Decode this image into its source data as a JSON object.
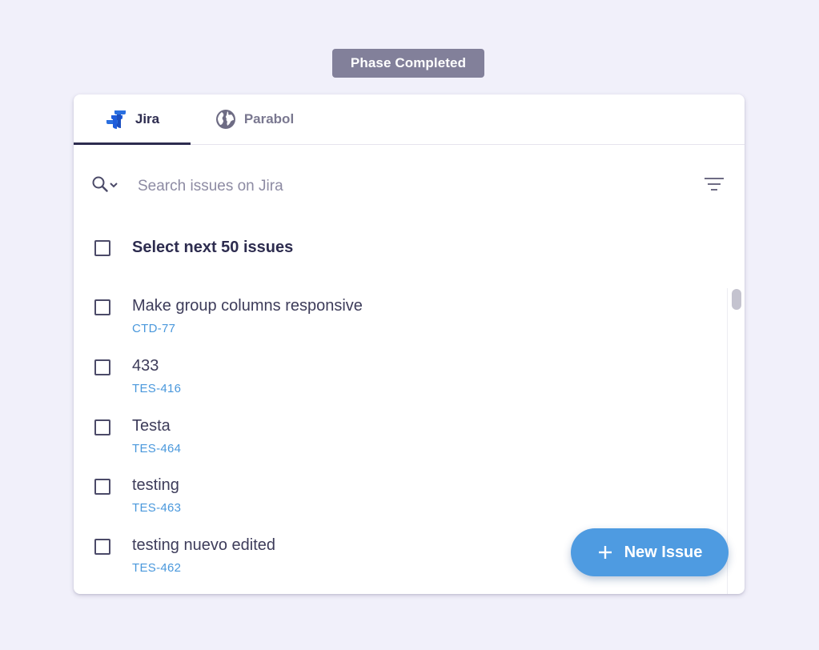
{
  "phase_badge": "Phase Completed",
  "tabs": [
    {
      "label": "Jira",
      "icon": "jira-icon",
      "active": true
    },
    {
      "label": "Parabol",
      "icon": "globe-icon",
      "active": false
    }
  ],
  "search": {
    "placeholder": "Search issues on Jira",
    "value": ""
  },
  "select_all_label": "Select next 50 issues",
  "issues": [
    {
      "title": "Make group columns responsive",
      "key": "CTD-77"
    },
    {
      "title": "433",
      "key": "TES-416"
    },
    {
      "title": "Testa",
      "key": "TES-464"
    },
    {
      "title": "testing",
      "key": "TES-463"
    },
    {
      "title": "testing nuevo edited",
      "key": "TES-462"
    }
  ],
  "new_issue_label": "New Issue",
  "colors": {
    "background": "#f1f0fa",
    "badge": "#82809a",
    "text_primary": "#2d2c4f",
    "text_muted": "#8d8ba3",
    "link_blue": "#4a98dc",
    "button_blue": "#4e9be1",
    "jira_blue": "#1f5ddb"
  }
}
